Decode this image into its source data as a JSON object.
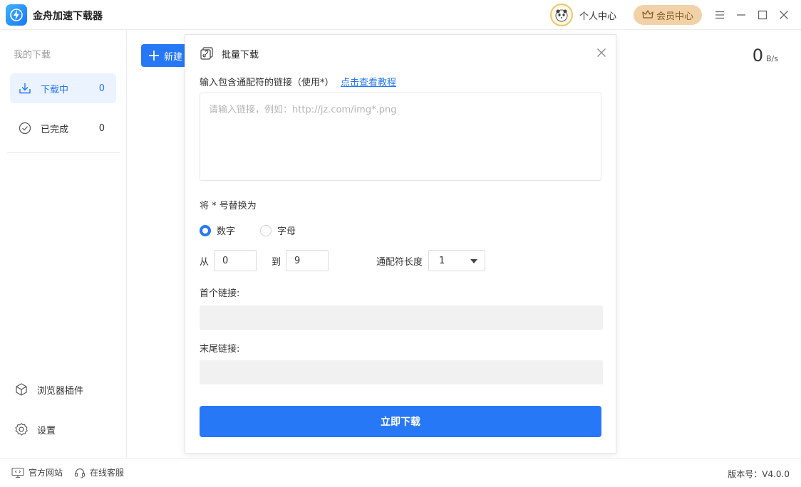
{
  "app": {
    "title": "金舟加速下载器"
  },
  "header": {
    "profile_label": "个人中心",
    "vip_label": "会员中心"
  },
  "sidebar": {
    "heading": "我的下载",
    "items": [
      {
        "label": "下载中",
        "count": "0"
      },
      {
        "label": "已完成",
        "count": "0"
      }
    ],
    "bottom": [
      {
        "label": "浏览器插件"
      },
      {
        "label": "设置"
      }
    ]
  },
  "main": {
    "new_button_label": "新建",
    "speed_value": "0",
    "speed_unit": "B/s"
  },
  "dialog": {
    "title": "批量下载",
    "url_label": "输入包含通配符的链接（使用*）",
    "tutorial_link": "点击查看教程",
    "url_placeholder": "请输入链接，例如：http://jz.com/img*.png",
    "replace_label": "将 * 号替换为",
    "radio_options": [
      {
        "label": "数字",
        "selected": true
      },
      {
        "label": "字母",
        "selected": false
      }
    ],
    "from_label": "从",
    "from_value": "0",
    "to_label": "到",
    "to_value": "9",
    "wildcard_length_label": "通配符长度",
    "wildcard_length_value": "1",
    "first_link_label": "首个链接:",
    "last_link_label": "末尾链接:",
    "submit_label": "立即下载"
  },
  "footer": {
    "website_label": "官方网站",
    "service_label": "在线客服",
    "version": "版本号：V4.0.0"
  },
  "colors": {
    "accent": "#2778f6",
    "vip_bg": "#f1d2a8",
    "active_bg": "#eaf3ff"
  }
}
